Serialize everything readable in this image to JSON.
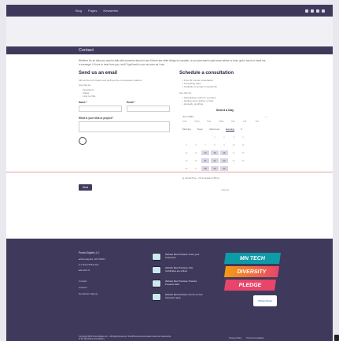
{
  "topnav": {
    "links": [
      "Blog",
      "Pages",
      "Newsletter"
    ]
  },
  "page": {
    "title": "Contact",
    "intro": "Whether it's an idea you want to talk with someone about to see if there are other things to consider, or you just want to get some advice or help, get in touch or send me a message. I'd love to hear from you, and I'll get back to you as soon as I can.",
    "email_section": {
      "heading": "Send us an email",
      "lead": "Fill out the form below and we'll get the conversation started.",
      "list_title": "Use this for:",
      "items": [
        "Questions",
        "Ideas",
        "Just to chat"
      ],
      "name_label": "Name *",
      "email_label": "Email *",
      "message_label": "What is your idea or project?",
      "send_label": "Send"
    },
    "consult_section": {
      "heading": "Schedule a consultation",
      "options": [
        "Free 30-minute consultation",
        "Consulting rates",
        "Available evenings & weekends"
      ],
      "use_title": "Use this for:",
      "use_items": [
        "Scheduling a plan for a project",
        "Getting some advice or help",
        "Honestly, anything"
      ],
      "calendar_title": "Select a Day",
      "month": "June 2022",
      "weekdays": [
        "SUN",
        "MON",
        "TUE",
        "WED",
        "THU",
        "FRI",
        "SAT"
      ],
      "tabs": [
        "Morning",
        "Noon",
        "Afternoon",
        "Evening"
      ],
      "active_tab": "Evening",
      "days": [
        {
          "d": "",
          "a": false
        },
        {
          "d": "",
          "a": false
        },
        {
          "d": "",
          "a": false
        },
        {
          "d": "1",
          "a": false
        },
        {
          "d": "2",
          "a": false
        },
        {
          "d": "3",
          "a": false
        },
        {
          "d": "4",
          "a": false
        },
        {
          "d": "5",
          "a": false
        },
        {
          "d": "6",
          "a": false
        },
        {
          "d": "7",
          "a": false
        },
        {
          "d": "8",
          "a": false
        },
        {
          "d": "9",
          "a": false
        },
        {
          "d": "10",
          "a": false
        },
        {
          "d": "11",
          "a": false
        },
        {
          "d": "12",
          "a": false
        },
        {
          "d": "13",
          "a": false
        },
        {
          "d": "14",
          "a": true
        },
        {
          "d": "15",
          "a": true
        },
        {
          "d": "16",
          "a": true
        },
        {
          "d": "17",
          "a": false
        },
        {
          "d": "18",
          "a": false
        },
        {
          "d": "19",
          "a": false
        },
        {
          "d": "20",
          "a": false
        },
        {
          "d": "21",
          "a": true
        },
        {
          "d": "22",
          "a": true
        },
        {
          "d": "23",
          "a": true
        },
        {
          "d": "24",
          "a": false
        },
        {
          "d": "25",
          "a": false
        },
        {
          "d": "26",
          "a": false
        },
        {
          "d": "27",
          "a": false
        },
        {
          "d": "28",
          "a": true
        },
        {
          "d": "29",
          "a": true
        },
        {
          "d": "30",
          "a": true
        },
        {
          "d": "",
          "a": false
        },
        {
          "d": "",
          "a": false
        }
      ],
      "timezone": "Central Time - US & Canada (1:35pm)",
      "powered": "Calendly"
    }
  },
  "footer": {
    "company": "Punta Digital LLC",
    "rows": [
      "Minneapolis, MN 55401",
      "1 (612) 555-0142",
      "Email Us"
    ],
    "links": [
      "Contact",
      "Careers",
      "Newsletter Signup"
    ],
    "posts": [
      "Website Best Practices: Know your Customers",
      "Website Best Practices: SSL Certificates are a Must",
      "Website Best Practices: Practice Proactive SEO",
      "Website Best Practices: Don't Let Your Accounts Lapse"
    ],
    "badges": [
      "MN TECH",
      "DIVERSITY",
      "PLEDGE"
    ],
    "partner": "HubSpot Partner",
    "copyright": "Copyright 2022 Punta Digital LLC - All Rights Reserved. WordPress and associated marks are trademarks of the WordPress Foundation.",
    "legal": [
      "Privacy Policy",
      "Terms & Conditions"
    ]
  },
  "colors": {
    "brand": "#3f3a5c",
    "teal": "#0f9aa8",
    "pink": "#e8456a",
    "orange": "#f39c12"
  }
}
